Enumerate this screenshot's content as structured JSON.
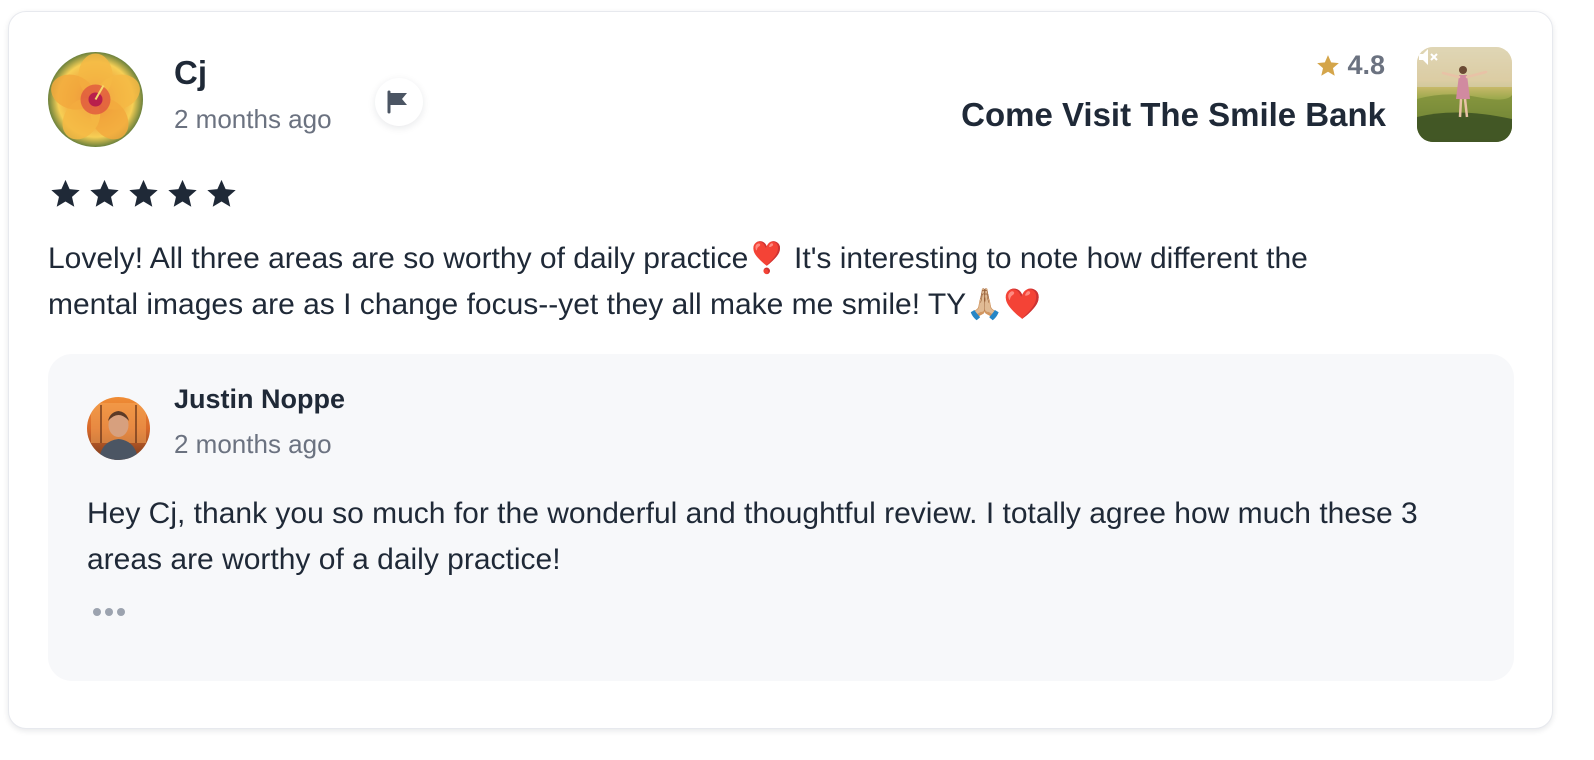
{
  "review": {
    "author_name": "Cj",
    "time_ago": "2 months ago",
    "stars": 5,
    "text": "Lovely! All three areas are so worthy of daily practice❣️ It's interesting to note how different the mental images are as I change focus--yet they all make me smile! TY🙏🏼❤️",
    "icons": {
      "flag": "flag-icon",
      "star": "star-icon"
    }
  },
  "product": {
    "rating": "4.8",
    "title": "Come Visit The Smile Bank",
    "icons": {
      "rating_star": "star-icon",
      "mute": "speaker-muted-icon"
    },
    "colors": {
      "rating_star": "#d4a54a"
    }
  },
  "reply": {
    "author_name": "Justin Noppe",
    "time_ago": "2 months ago",
    "text": "Hey Cj, thank you so much for the wonderful and thoughtful review. I totally agree how much these 3 areas are worthy of a daily practice!",
    "icons": {
      "more": "ellipsis-icon"
    }
  },
  "colors": {
    "text_primary": "#1f2937",
    "text_secondary": "#6b7280",
    "reply_background": "#f7f8fa"
  }
}
